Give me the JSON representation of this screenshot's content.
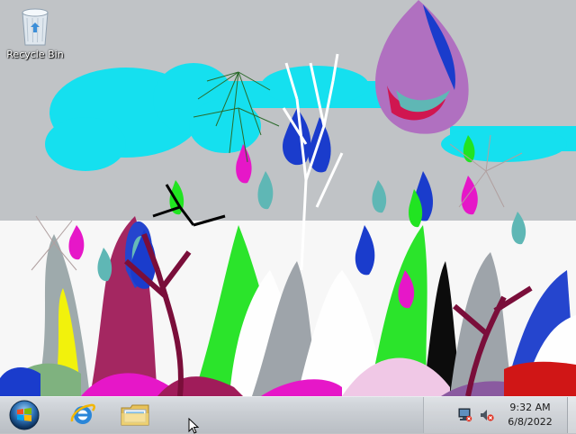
{
  "desktop": {
    "icons": [
      {
        "label": "Recycle Bin",
        "icon": "recycle-bin-icon"
      }
    ]
  },
  "taskbar": {
    "start_icon": "windows-orb-icon",
    "pinned": [
      {
        "name": "Internet Explorer",
        "icon": "internet-explorer-icon"
      },
      {
        "name": "Windows Explorer",
        "icon": "folder-icon"
      }
    ],
    "tray": {
      "icons": [
        "network-icon",
        "volume-muted-icon"
      ],
      "clock": {
        "time": "9:32 AM",
        "date": "6/8/2022"
      }
    }
  },
  "colors": {
    "taskbar": "#c9cdd2",
    "sky": "#c0c3c6",
    "clouds": "#15e0ef",
    "accent_blue": "#1a3ccc",
    "magenta": "#e617c8",
    "green": "#21e421"
  }
}
